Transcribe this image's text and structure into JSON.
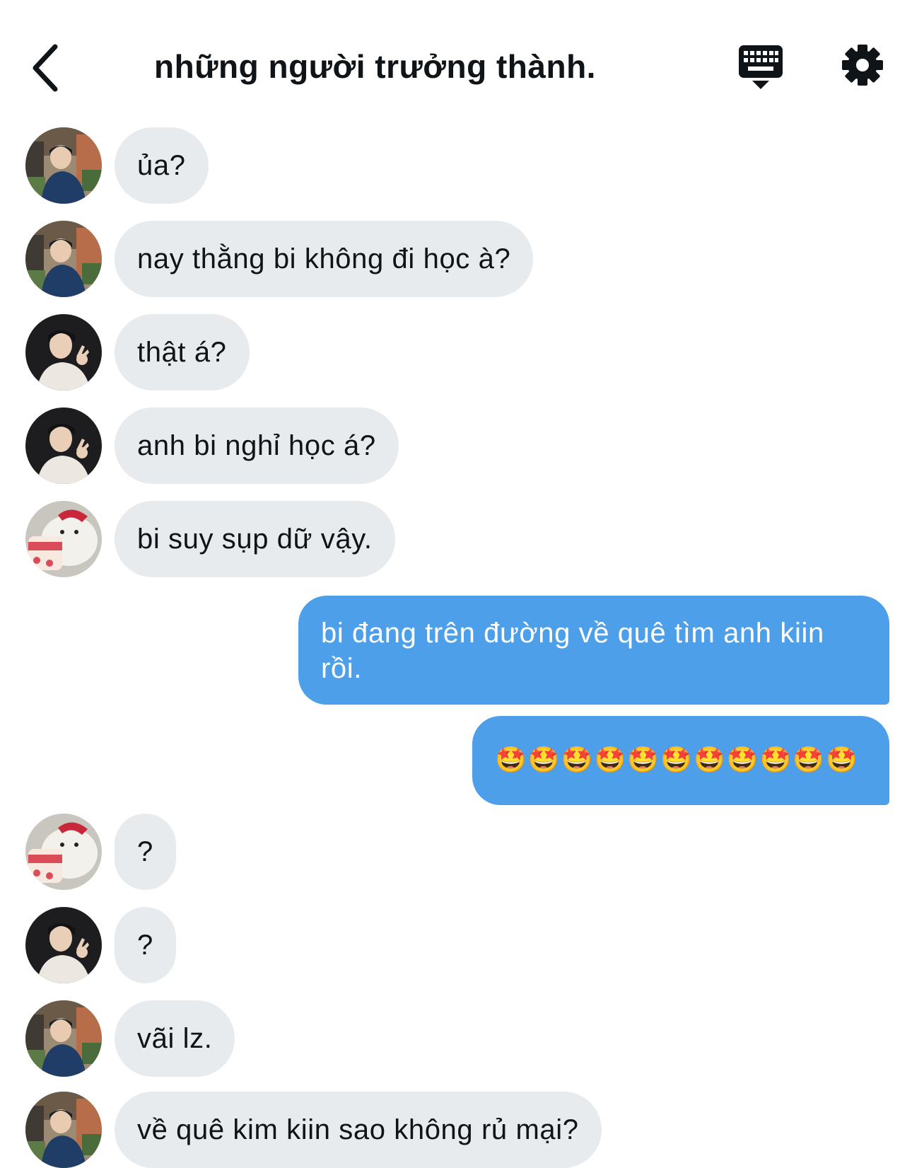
{
  "header": {
    "title": "những người trưởng thành.",
    "back_icon": "chevron-left-icon",
    "keyboard_icon": "keyboard-icon",
    "settings_icon": "gear-icon"
  },
  "messages": [
    {
      "sender": "avatar-a",
      "text": "ủa?"
    },
    {
      "sender": "avatar-a",
      "text": "nay thằng bi không đi học à?"
    },
    {
      "sender": "avatar-b",
      "text": "thật á?"
    },
    {
      "sender": "avatar-b",
      "text": "anh bi nghỉ học á?"
    },
    {
      "sender": "avatar-c",
      "text": "bi suy sụp dữ vậy."
    },
    {
      "sender": "me",
      "text": "bi đang trên đường về quê tìm anh kiin rồi."
    },
    {
      "sender": "me",
      "text": "🤩🤩🤩🤩🤩🤩🤩🤩🤩🤩🤩"
    },
    {
      "sender": "avatar-c",
      "text": "?"
    },
    {
      "sender": "avatar-b",
      "text": "?"
    },
    {
      "sender": "avatar-a",
      "text": "vãi lz."
    },
    {
      "sender": "avatar-a",
      "text": "về quê kim kiin sao không rủ mại?"
    }
  ],
  "colors": {
    "incoming_bubble": "#e7ebee",
    "outgoing_bubble": "#4d9fea",
    "text": "#0f1419"
  }
}
